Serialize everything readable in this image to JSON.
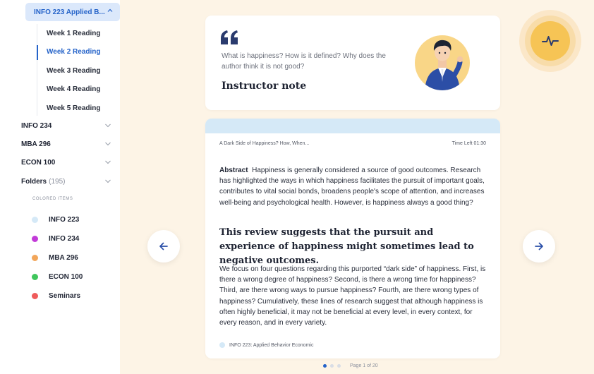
{
  "sidebar": {
    "active_course": "INFO 223 Applied B...",
    "weeks": [
      {
        "label": "Week 1 Reading",
        "active": false
      },
      {
        "label": "Week 2 Reading",
        "active": true
      },
      {
        "label": "Week 3 Reading",
        "active": false
      },
      {
        "label": "Week 4 Reading",
        "active": false
      },
      {
        "label": "Week 5 Reading",
        "active": false
      }
    ],
    "courses": [
      "INFO 234",
      "MBA 296",
      "ECON 100"
    ],
    "folders_label": "Folders",
    "folders_count": "(195)",
    "colored_heading": "COLORED ITEMS",
    "colored_items": [
      {
        "label": "INFO 223",
        "color": "#d5e9f7"
      },
      {
        "label": "INFO 234",
        "color": "#c23bd8"
      },
      {
        "label": "MBA 296",
        "color": "#f2a65a"
      },
      {
        "label": "ECON 100",
        "color": "#3fc65c"
      },
      {
        "label": "Seminars",
        "color": "#ef5b5b"
      }
    ]
  },
  "note": {
    "question": "What is happiness? How is it defined? Why does the author think it is not good?",
    "title": "Instructor note",
    "quote_icon": "quote-icon",
    "avatar": "instructor-avatar"
  },
  "reading": {
    "doc_title": "A Dark Side of Happiness? How, When...",
    "time_left": "Time Left 01:30",
    "abstract_label": "Abstract",
    "abstract_text": "Happiness is generally considered a source of good outcomes. Research has highlighted the ways in which happiness facilitates the  pursuit of important goals, contributes to vital social bonds, broadens people's scope of attention, and increases well-being and  psychological health. However, is happiness always a good thing?",
    "pull_quote": "This review suggests that the pursuit and experience of happiness might sometimes lead to negative outcomes.",
    "body": "We focus on four questions regarding this purported “dark side” of happiness. First, is there a wrong degree of happiness? Second, is there a wrong time for happiness? Third, are there wrong ways to pursue happiness?  Fourth, are there wrong types of happiness? Cumulatively, these lines of research suggest that although happiness is often  highly beneficial, it may not be beneficial at every level, in every context, for every reason, and in every variety.",
    "course_tag": "INFO 223: Applied Behavior Economic",
    "course_tag_color": "#d5e9f7"
  },
  "nav": {
    "prev_icon": "arrow-left-icon",
    "next_icon": "arrow-right-icon",
    "pulse_icon": "activity-pulse-icon"
  },
  "pager": {
    "label": "Page 1 of 20",
    "current": 1
  },
  "colors": {
    "accent": "#2563c9",
    "pulse": "#f6c455",
    "background": "#fdf4e6"
  }
}
